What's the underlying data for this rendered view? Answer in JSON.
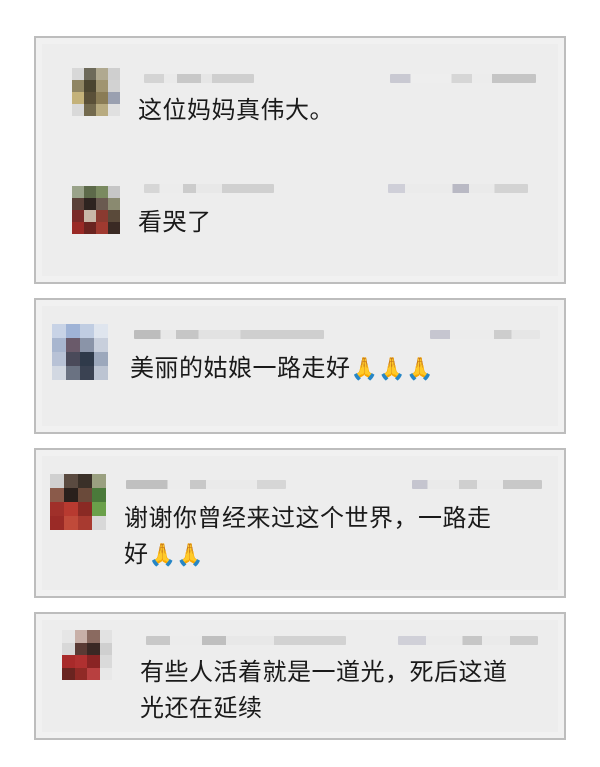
{
  "comments": [
    {
      "text": "这位妈妈真伟大。"
    },
    {
      "text": "看哭了"
    },
    {
      "text": "美丽的姑娘一路走好",
      "emoji": "🙏🙏🙏"
    },
    {
      "line1": "谢谢你曾经来过这个世界，一路走",
      "line2": "好",
      "emoji": "🙏🙏"
    },
    {
      "line1": "有些人活着就是一道光，死后这道",
      "line2": "光还在延续"
    }
  ],
  "colors": {
    "card_border": "#bdbdbd",
    "card_bg": "#ededed",
    "text": "#1a1a1a"
  }
}
